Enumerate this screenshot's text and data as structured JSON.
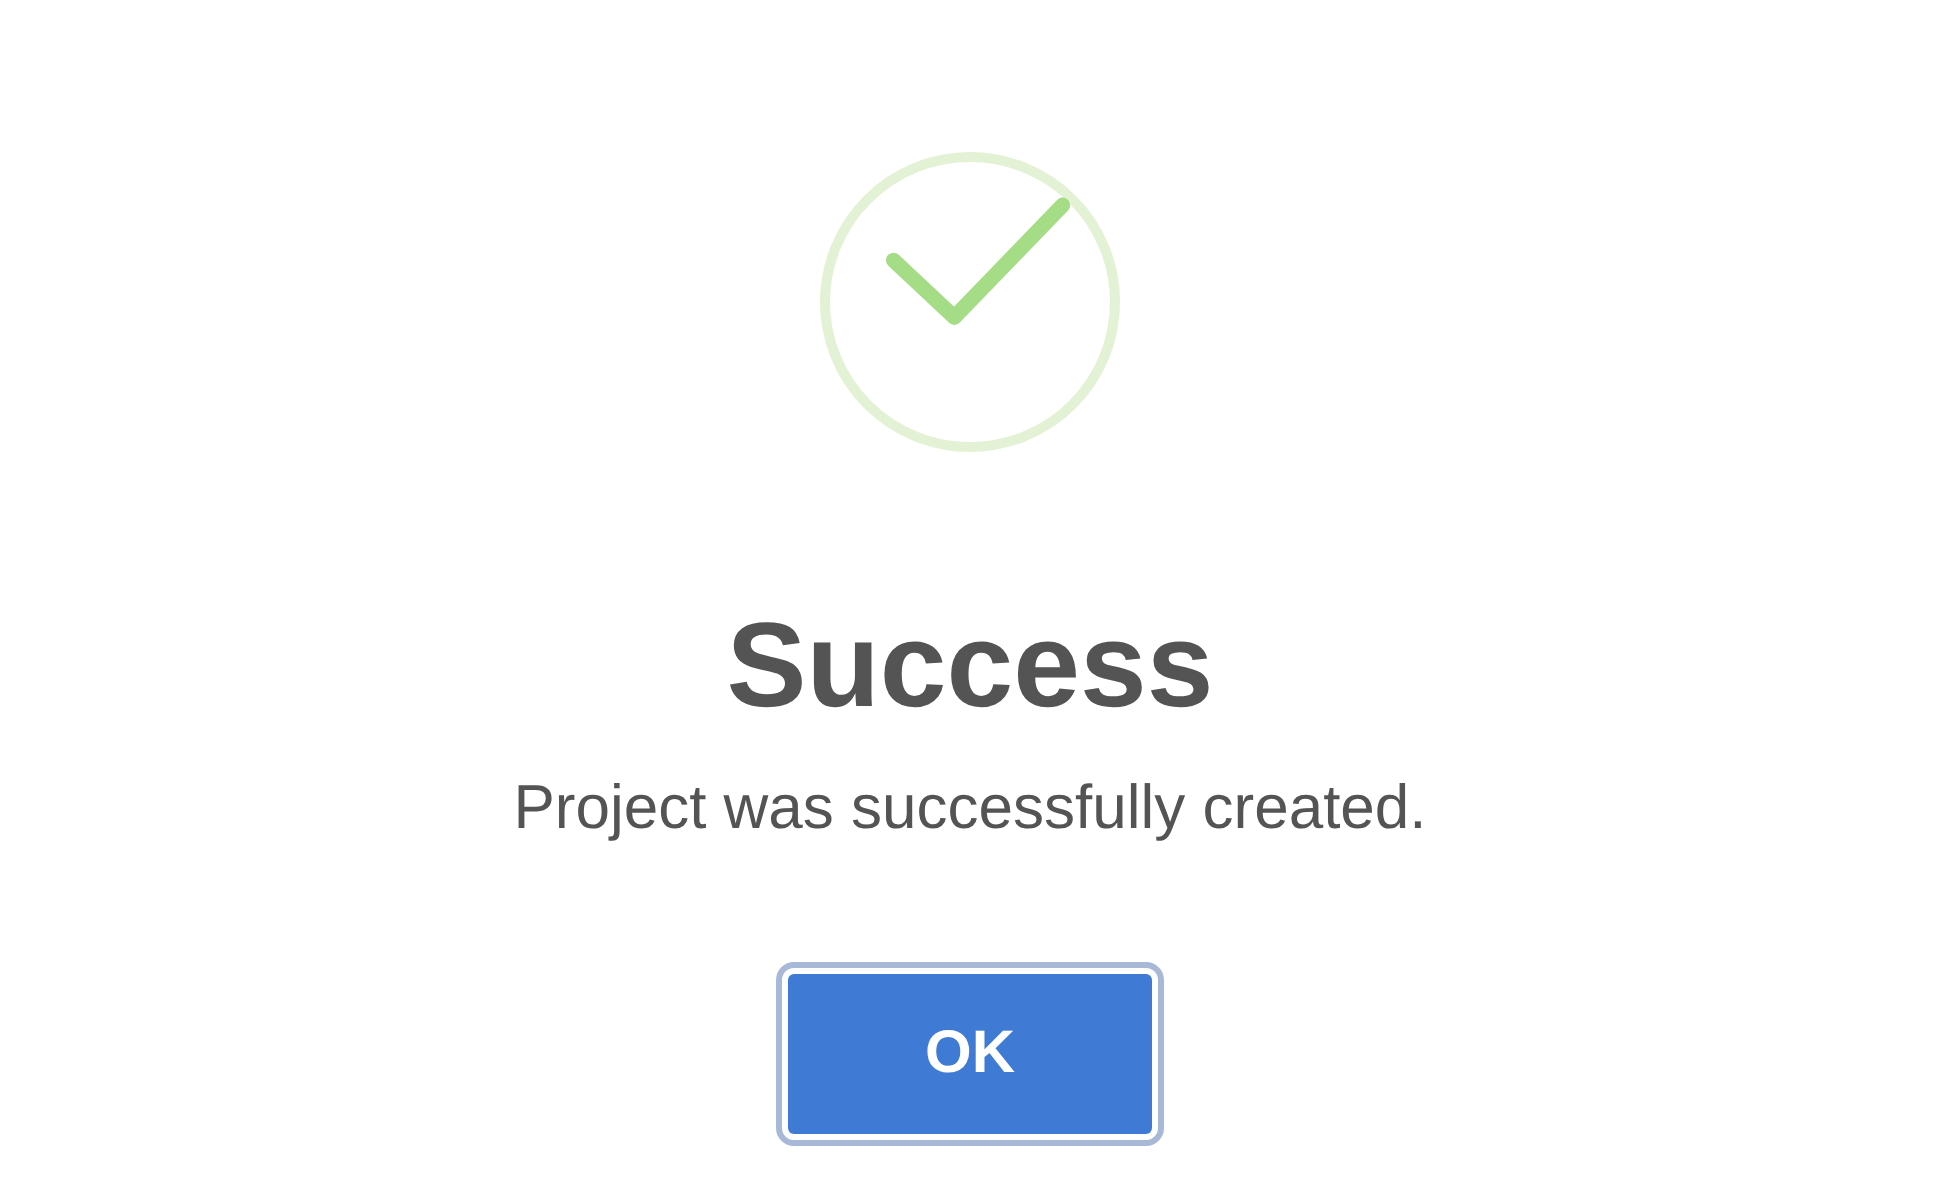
{
  "dialog": {
    "kind": "success",
    "title": "Success",
    "message": "Project was successfully created.",
    "button": {
      "label": "OK",
      "focused": true
    }
  }
}
